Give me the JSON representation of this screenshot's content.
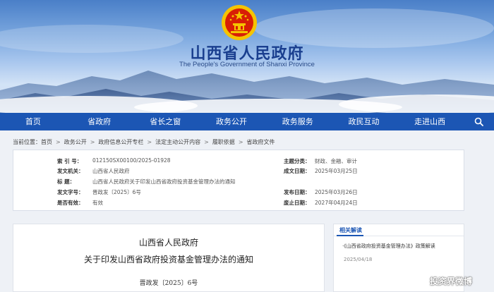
{
  "header": {
    "site_title": "山西省人民政府",
    "site_subtitle": "The People's Government of Shanxi Province"
  },
  "nav": {
    "items": [
      "首页",
      "省政府",
      "省长之窗",
      "政务公开",
      "政务服务",
      "政民互动",
      "走进山西"
    ],
    "search_icon": "search-icon"
  },
  "breadcrumb": {
    "prefix": "当前位置：",
    "items": [
      "首页",
      "政务公开",
      "政府信息公开专栏",
      "法定主动公开内容",
      "履职依据",
      "省政府文件"
    ]
  },
  "metadata": {
    "index_label": "索  引  号：",
    "index_value": "012150SX00100/2025-01928",
    "topic_label": "主题分类：",
    "topic_value": "财政、金融、审计",
    "issuer_label": "发文机关：",
    "issuer_value": "山西省人民政府",
    "created_label": "成文日期：",
    "created_value": "2025年03月25日",
    "title_label": "标    题：",
    "title_value": "山西省人民政府关于印发山西省政府投资基金管理办法的通知",
    "docno_label": "发文字号：",
    "docno_value": "晋政发〔2025〕6号",
    "published_label": "发布日期：",
    "published_value": "2025年03月26日",
    "valid_label": "是否有效：",
    "valid_value": "有效",
    "expire_label": "废止日期：",
    "expire_value": "2027年04月24日"
  },
  "article": {
    "issuer": "山西省人民政府",
    "title": "关于印发山西省政府投资基金管理办法的通知",
    "doc_number": "晋政发〔2025〕6号"
  },
  "sidebar": {
    "heading": "相关解读",
    "link": "·《山西省政府投资基金管理办法》政策解读",
    "date": "2025/04/18"
  },
  "watermark": {
    "text": "投资界微博"
  },
  "colors": {
    "nav_bg": "#1c56b4",
    "title_blue": "#1a3f8f",
    "emblem_red": "#d81e06",
    "emblem_gold": "#f5c400"
  }
}
